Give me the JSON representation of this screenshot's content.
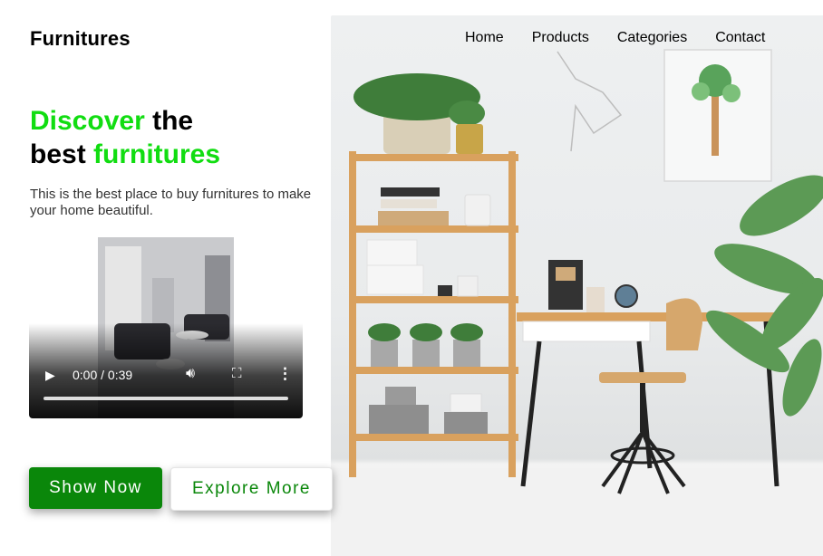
{
  "brand": "Furnitures",
  "nav": [
    "Home",
    "Products",
    "Categories",
    "Contact"
  ],
  "hero": {
    "line1_green": "Discover",
    "line1_rest": "the",
    "line2_start": "best",
    "line2_green": "furnitures",
    "description": "This is the best place to buy furnitures to make your home beautiful."
  },
  "video": {
    "time": "0:00 / 0:39",
    "progress": 0
  },
  "buttons": {
    "primary": "Show Now",
    "secondary": "Explore More"
  },
  "colors": {
    "accent_green": "#11dd11",
    "button_green": "#0a870a"
  },
  "icons": {
    "play": "play-icon",
    "volume": "volume-icon",
    "fullscreen": "fullscreen-icon",
    "more": "more-vertical-icon"
  }
}
